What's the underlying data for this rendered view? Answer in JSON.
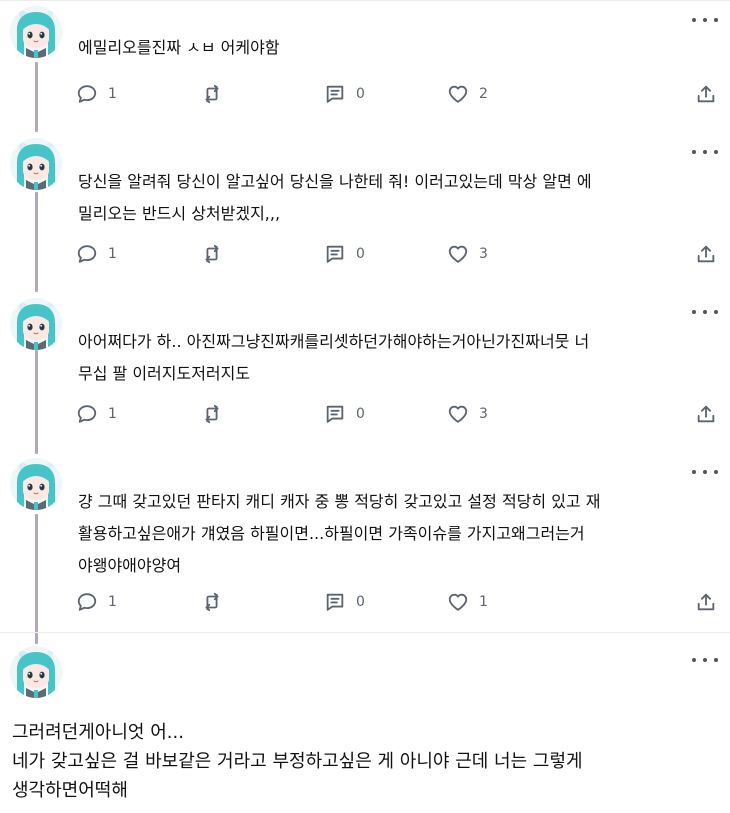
{
  "posts": [
    {
      "text": "에밀리오를진짜 ㅅㅂ 어케야함",
      "replies": "1",
      "reposts": "",
      "quotes": "0",
      "likes": "2"
    },
    {
      "text": "당신을 알려줘 당신이 알고싶어 당신을 나한테 줘! 이러고있는데 막상 알면 에\n밀리오는 반드시 상처받겠지,,,",
      "replies": "1",
      "reposts": "",
      "quotes": "0",
      "likes": "3"
    },
    {
      "text": "아어쩌다가 하.. 아진짜그냥진짜캐를리셋하던가해야하는거아닌가진짜너뭇 너\n무십 팔 이러지도저러지도",
      "replies": "1",
      "reposts": "",
      "quotes": "0",
      "likes": "3"
    },
    {
      "text": "걍 그때 갖고있던 판타지 캐디 캐자 중 뽕 적당히 갖고있고 설정 적당히 있고 재\n활용하고싶은애가 걔였음 하필이면...하필이면 가족이슈를 가지고왜그러는거\n야왱야애야양여",
      "replies": "1",
      "reposts": "",
      "quotes": "0",
      "likes": "1"
    }
  ],
  "reply": {
    "text": "그러려던게아니엇 어...\n네가 갖고싶은 걸 바보같은 거라고 부정하고싶은 게 아니야 근데 너는 그렇게\n생각하면어떡해"
  },
  "icons": {
    "reply": "speech-bubble-icon",
    "repost": "repost-arrows-icon",
    "quote": "quote-box-icon",
    "like": "heart-icon",
    "share": "share-upload-icon",
    "more": "more-dots-icon"
  },
  "colors": {
    "thread_line": "#b3a6b9",
    "icon": "#5b6470",
    "text": "#111111",
    "avatar_hair": "#46c4c8"
  }
}
